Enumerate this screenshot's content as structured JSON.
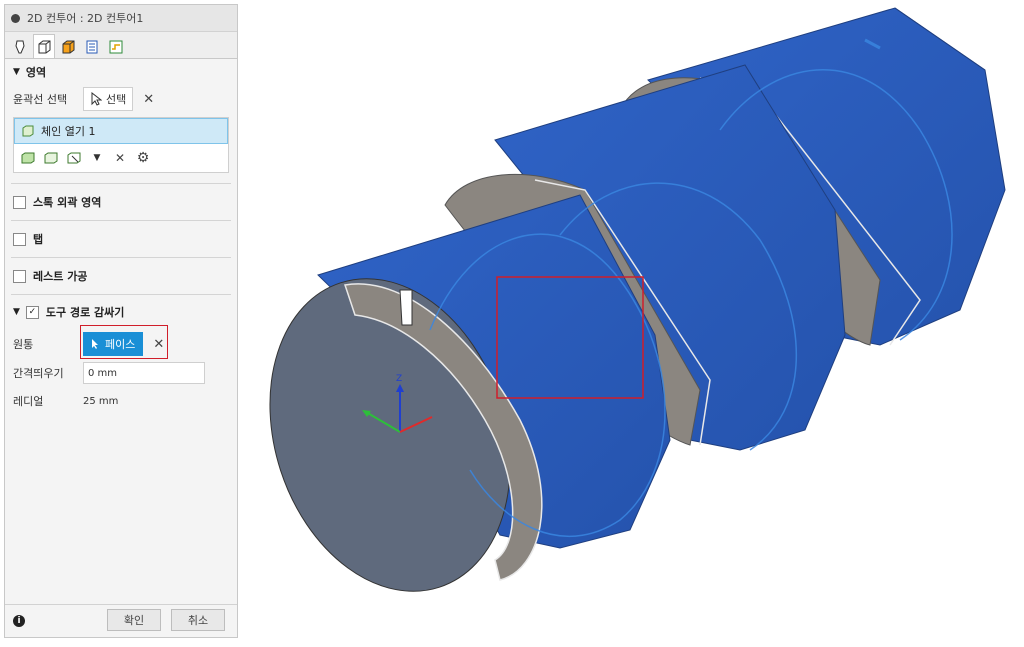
{
  "panel": {
    "title": "2D 컨투어 : 2D 컨투어1",
    "tabs": [
      "tool-icon",
      "geometry-icon",
      "heights-icon",
      "passes-icon",
      "linking-icon"
    ],
    "geometry_section": {
      "header": "영역",
      "contour_label": "윤곽선 선택",
      "select_button": "선택",
      "chain_item": "체인 열기 1"
    },
    "stock_contour": {
      "label": "스톡 외곽 영역",
      "checked": false
    },
    "tabs_option": {
      "label": "탭",
      "checked": false
    },
    "rest_machining": {
      "label": "레스트 가공",
      "checked": false
    },
    "tool_path_wrap": {
      "label": "도구 경로 감싸기",
      "checked": true,
      "cylinder_label": "원통",
      "face_button": "페이스",
      "gap_label": "간격띄우기",
      "gap_value": "0 mm",
      "radial_label": "레디얼",
      "radial_value": "25 mm"
    },
    "footer": {
      "ok": "확인",
      "cancel": "취소"
    }
  },
  "viewport": {
    "axis_label": "Z",
    "colors": {
      "body": "#2e5ebc",
      "face": "#8a8580",
      "redbox": "#d01e2a"
    }
  }
}
